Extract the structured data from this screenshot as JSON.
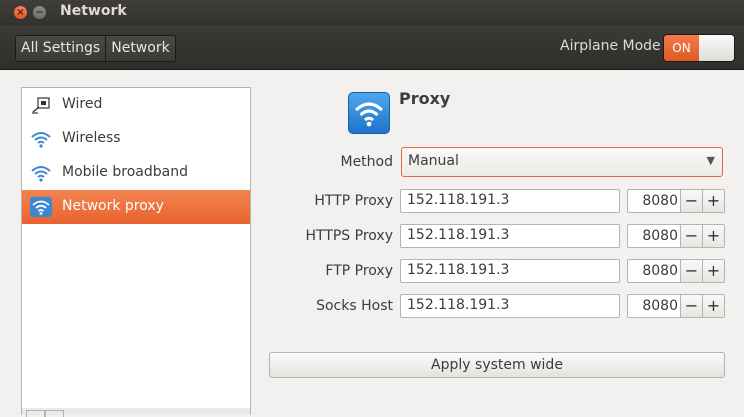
{
  "window": {
    "title": "Network"
  },
  "toolbar": {
    "breadcrumbs": [
      "All Settings",
      "Network"
    ],
    "airplane_label": "Airplane Mode",
    "airplane_state": "ON"
  },
  "sidebar": {
    "items": [
      {
        "label": "Wired",
        "icon": "wired-network-icon"
      },
      {
        "label": "Wireless",
        "icon": "wireless-icon"
      },
      {
        "label": "Mobile broadband",
        "icon": "mobile-broadband-icon"
      },
      {
        "label": "Network proxy",
        "icon": "network-proxy-icon",
        "selected": true
      }
    ]
  },
  "proxy": {
    "title": "Proxy",
    "method_label": "Method",
    "method_value": "Manual",
    "rows": [
      {
        "label": "HTTP Proxy",
        "host": "152.118.191.3",
        "port": "8080"
      },
      {
        "label": "HTTPS Proxy",
        "host": "152.118.191.3",
        "port": "8080"
      },
      {
        "label": "FTP Proxy",
        "host": "152.118.191.3",
        "port": "8080"
      },
      {
        "label": "Socks Host",
        "host": "152.118.191.3",
        "port": "8080"
      }
    ],
    "minus": "−",
    "plus": "+",
    "apply_label": "Apply system wide"
  },
  "colors": {
    "accent": "#e8632e",
    "titlebar": "#3c3b37"
  }
}
